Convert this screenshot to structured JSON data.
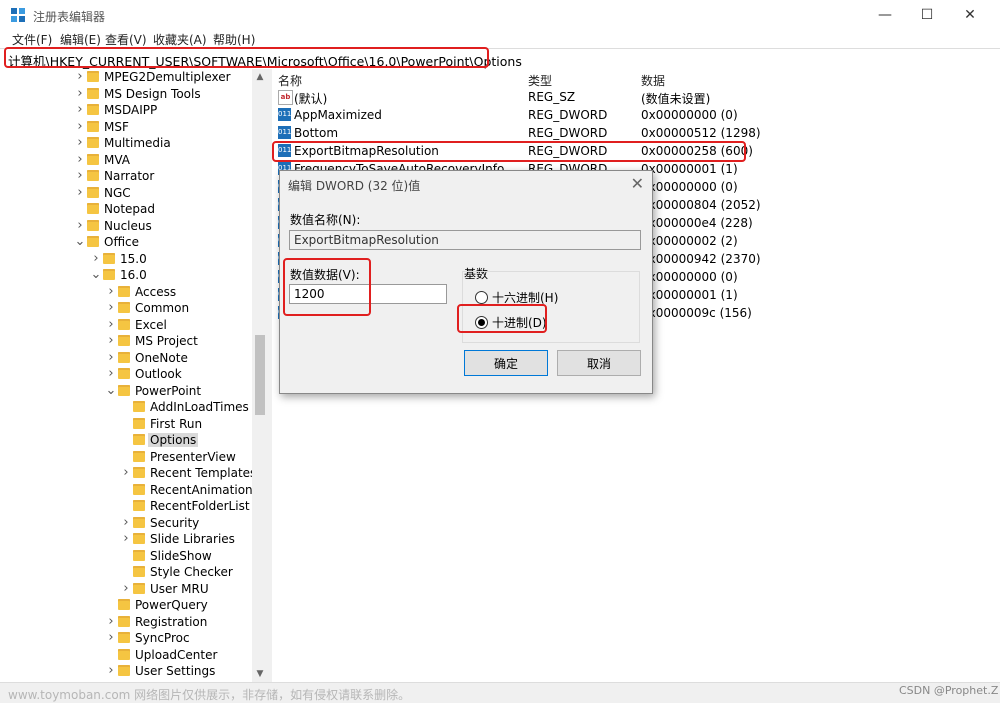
{
  "window": {
    "title": "注册表编辑器",
    "controls": {
      "minimize": "—",
      "maximize": "☐",
      "close": "✕"
    }
  },
  "menu": [
    "文件(F)",
    "编辑(E)",
    "查看(V)",
    "收藏夹(A)",
    "帮助(H)"
  ],
  "address": "计算机\\HKEY_CURRENT_USER\\SOFTWARE\\Microsoft\\Office\\16.0\\PowerPoint\\Options",
  "tree": [
    {
      "label": "MPEG2Demultiplexer",
      "level": 0,
      "expander": ">"
    },
    {
      "label": "MS Design Tools",
      "level": 0,
      "expander": ">"
    },
    {
      "label": "MSDAIPP",
      "level": 0,
      "expander": ">"
    },
    {
      "label": "MSF",
      "level": 0,
      "expander": ">"
    },
    {
      "label": "Multimedia",
      "level": 0,
      "expander": ">"
    },
    {
      "label": "MVA",
      "level": 0,
      "expander": ">"
    },
    {
      "label": "Narrator",
      "level": 0,
      "expander": ">"
    },
    {
      "label": "NGC",
      "level": 0,
      "expander": ">"
    },
    {
      "label": "Notepad",
      "level": 0,
      "expander": ""
    },
    {
      "label": "Nucleus",
      "level": 0,
      "expander": ">"
    },
    {
      "label": "Office",
      "level": 0,
      "expander": "v"
    },
    {
      "label": "15.0",
      "level": 1,
      "expander": ">"
    },
    {
      "label": "16.0",
      "level": 1,
      "expander": "v"
    },
    {
      "label": "Access",
      "level": 2,
      "expander": ">"
    },
    {
      "label": "Common",
      "level": 2,
      "expander": ">"
    },
    {
      "label": "Excel",
      "level": 2,
      "expander": ">"
    },
    {
      "label": "MS Project",
      "level": 2,
      "expander": ">"
    },
    {
      "label": "OneNote",
      "level": 2,
      "expander": ">"
    },
    {
      "label": "Outlook",
      "level": 2,
      "expander": ">"
    },
    {
      "label": "PowerPoint",
      "level": 2,
      "expander": "v"
    },
    {
      "label": "AddInLoadTimes",
      "level": 3,
      "expander": ""
    },
    {
      "label": "First Run",
      "level": 3,
      "expander": ""
    },
    {
      "label": "Options",
      "level": 3,
      "expander": "",
      "selected": true
    },
    {
      "label": "PresenterView",
      "level": 3,
      "expander": ""
    },
    {
      "label": "Recent Templates",
      "level": 3,
      "expander": ">"
    },
    {
      "label": "RecentAnimationL",
      "level": 3,
      "expander": ""
    },
    {
      "label": "RecentFolderList",
      "level": 3,
      "expander": ""
    },
    {
      "label": "Security",
      "level": 3,
      "expander": ">"
    },
    {
      "label": "Slide Libraries",
      "level": 3,
      "expander": ">"
    },
    {
      "label": "SlideShow",
      "level": 3,
      "expander": ""
    },
    {
      "label": "Style Checker",
      "level": 3,
      "expander": ""
    },
    {
      "label": "User MRU",
      "level": 3,
      "expander": ">"
    },
    {
      "label": "PowerQuery",
      "level": 2,
      "expander": ""
    },
    {
      "label": "Registration",
      "level": 2,
      "expander": ">"
    },
    {
      "label": "SyncProc",
      "level": 2,
      "expander": ">"
    },
    {
      "label": "UploadCenter",
      "level": 2,
      "expander": ""
    },
    {
      "label": "User Settings",
      "level": 2,
      "expander": ">"
    }
  ],
  "columns": {
    "name": "名称",
    "type": "类型",
    "data": "数据"
  },
  "values": [
    {
      "icon": "ab",
      "name": "(默认)",
      "type": "REG_SZ",
      "data": "(数值未设置)"
    },
    {
      "icon": "dword",
      "name": "AppMaximized",
      "type": "REG_DWORD",
      "data": "0x00000000 (0)"
    },
    {
      "icon": "dword",
      "name": "Bottom",
      "type": "REG_DWORD",
      "data": "0x00000512 (1298)"
    },
    {
      "icon": "dword",
      "name": "ExportBitmapResolution",
      "type": "REG_DWORD",
      "data": "0x00000258 (600)"
    },
    {
      "icon": "dword",
      "name": "FrequencyToSaveAutoRecoveryInfo",
      "type": "REG_DWORD",
      "data": "0x00000001 (1)"
    },
    {
      "icon": "dword",
      "name": "",
      "type": "",
      "data": "0x00000000 (0)"
    },
    {
      "icon": "dword",
      "name": "",
      "type": "",
      "data": "0x00000804 (2052)"
    },
    {
      "icon": "dword",
      "name": "",
      "type": "",
      "data": "0x000000e4 (228)"
    },
    {
      "icon": "dword",
      "name": "",
      "type": "",
      "data": "0x00000002 (2)"
    },
    {
      "icon": "dword",
      "name": "",
      "type": "",
      "data": "0x00000942 (2370)"
    },
    {
      "icon": "dword",
      "name": "",
      "type": "",
      "data": "0x00000000 (0)"
    },
    {
      "icon": "dword",
      "name": "",
      "type": "",
      "data": "0x00000001 (1)"
    },
    {
      "icon": "dword",
      "name": "",
      "type": "",
      "data": "0x0000009c (156)"
    }
  ],
  "dialog": {
    "title": "编辑 DWORD (32 位)值",
    "close": "✕",
    "name_label": "数值名称(N):",
    "name_value": "ExportBitmapResolution",
    "data_label": "数值数据(V):",
    "data_value": "1200",
    "base_label": "基数",
    "hex_label": "十六进制(H)",
    "dec_label": "十进制(D)",
    "selected_base": "dec",
    "ok": "确定",
    "cancel": "取消"
  },
  "watermark": "www.toymoban.com 网络图片仅供展示，非存储，如有侵权请联系删除。",
  "credit": "CSDN @Prophet.Z",
  "colors": {
    "highlight_red": "#e01f1f",
    "folder": "#f5c542",
    "dword_icon": "#1d6fb8"
  }
}
